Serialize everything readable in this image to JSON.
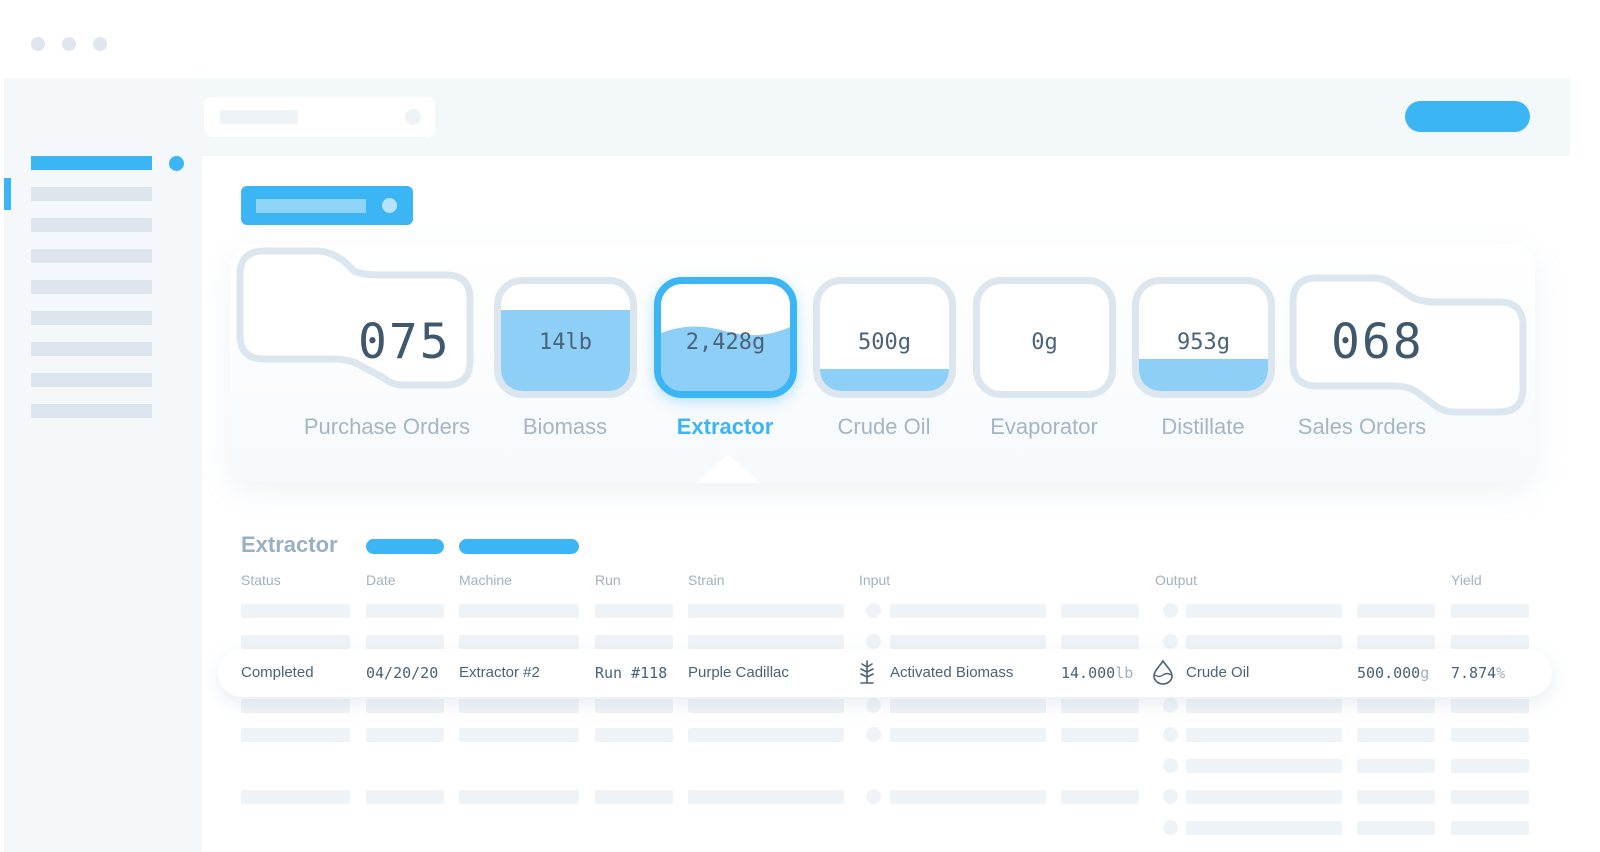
{
  "stages": [
    {
      "value": "075",
      "label": "Purchase Orders",
      "fill_fraction": 0,
      "active": false
    },
    {
      "value": "14lb",
      "label": "Biomass",
      "fill_fraction": 0.75,
      "active": false
    },
    {
      "value": "2,428g",
      "label": "Extractor",
      "fill_fraction": 0.5,
      "active": true
    },
    {
      "value": "500g",
      "label": "Crude Oil",
      "fill_fraction": 0.2,
      "active": false
    },
    {
      "value": "0g",
      "label": "Evaporator",
      "fill_fraction": 0,
      "active": false
    },
    {
      "value": "953g",
      "label": "Distillate",
      "fill_fraction": 0.3,
      "active": false
    },
    {
      "value": "068",
      "label": "Sales Orders",
      "fill_fraction": 0,
      "active": false
    }
  ],
  "section": {
    "title": "Extractor"
  },
  "table": {
    "headers": [
      "Status",
      "Date",
      "Machine",
      "Run",
      "Strain",
      "Input",
      "Output",
      "Yield"
    ],
    "row": {
      "status": "Completed",
      "date": "04/20/20",
      "machine": "Extractor #2",
      "run": "Run #118",
      "strain": "Purple Cadillac",
      "input_name": "Activated Biomass",
      "input_qty": "14.000",
      "input_unit": "lb",
      "output_name": "Crude Oil",
      "output_qty": "500.000",
      "output_unit": "g",
      "yield": "7.874",
      "yield_unit": "%"
    }
  },
  "icons": {
    "input": "plant-icon",
    "output": "oil-drop-icon"
  },
  "colors": {
    "accent": "#3cb5f4",
    "liquid": "#8ecff7",
    "muted": "#a5b5c3"
  }
}
